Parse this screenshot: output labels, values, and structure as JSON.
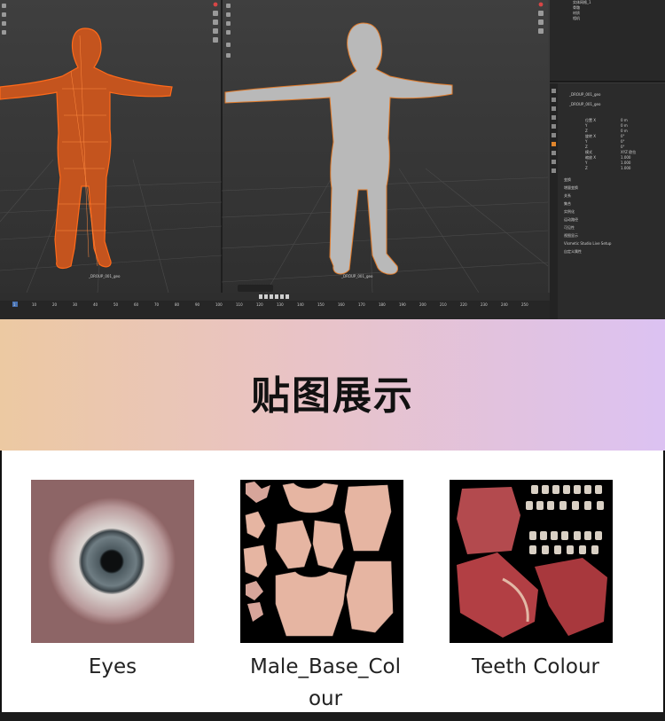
{
  "banner": {
    "title": "贴图展示"
  },
  "viewport": {
    "left_object_label": "_DROUP_001_geo",
    "right_object_label": "_DROUP_001_geo",
    "properties_object_name": "_DROUP_001_geo",
    "timeline_ticks": [
      "10",
      "20",
      "30",
      "40",
      "50",
      "60",
      "70",
      "80",
      "90",
      "100",
      "110",
      "120",
      "130",
      "140",
      "150",
      "160",
      "170",
      "180",
      "190",
      "200",
      "210",
      "220",
      "230",
      "240",
      "250"
    ],
    "timeline_current_frame": "1",
    "properties_sections": [
      "变换",
      "增量变换",
      "关系",
      "集合",
      "实例化",
      "运动路径",
      "可见性",
      "视图显示",
      "Vismetic Studio Live Setup",
      "自定义属性"
    ],
    "properties_labels": [
      "位置 X",
      "Y",
      "Z",
      "旋转 X",
      "Y",
      "Z",
      "模式",
      "缩放 X",
      "Y",
      "Z"
    ],
    "properties_values": [
      "0 m",
      "0 m",
      "0 m",
      "0°",
      "0°",
      "0°",
      "XYZ 欧拉",
      "1.000",
      "1.000",
      "1.000"
    ],
    "outliner_items": [
      "实体网格_1",
      "骨骼",
      "材质",
      "相机"
    ]
  },
  "gallery": {
    "items": [
      {
        "label": "Eyes"
      },
      {
        "label_line1": "Male_Base_Col",
        "label_line2": "our"
      },
      {
        "label": "Teeth Colour"
      }
    ]
  }
}
